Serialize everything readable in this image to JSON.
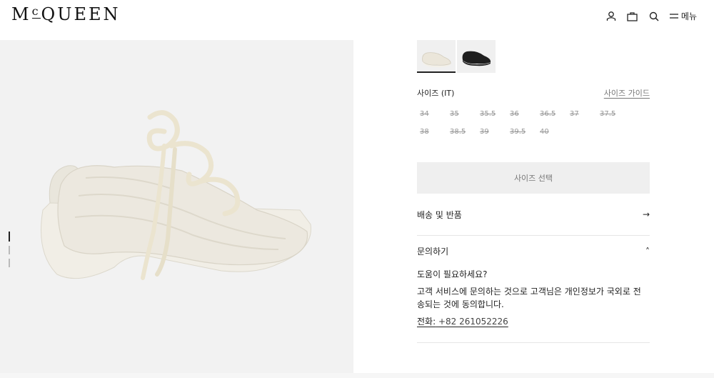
{
  "header": {
    "logo": "McQUEEN",
    "logo_display_left": "M",
    "logo_display_c": "c",
    "logo_display_right": "QUEEN",
    "icons": [
      "user-icon",
      "bag-icon",
      "search-icon",
      "menu-icon"
    ],
    "menu_label": "메뉴"
  },
  "gallery": {
    "image": "ivory-leather-sneaker",
    "pager_count": 3,
    "active_index": 0
  },
  "product": {
    "swatches": [
      {
        "name": "ivory",
        "selected": true
      },
      {
        "name": "black",
        "selected": false
      }
    ],
    "size_label": "사이즈 (IT)",
    "size_guide_label": "사이즈 가이드",
    "sizes": [
      "34",
      "35",
      "35.5",
      "36",
      "36.5",
      "37",
      "37.5",
      "38",
      "38.5",
      "39",
      "39.5",
      "40"
    ],
    "select_size_label": "사이즈 선택",
    "shipping_label": "배송 및 반품",
    "shipping_arrow": "→",
    "inquiry_label": "문의하기",
    "inquiry_caret": "˄",
    "help_question": "도움이 필요하세요?",
    "consent_text": "고객 서비스에 문의하는 것으로 고객님은 개인정보가 국외로 전송되는 것에 동의합니다.",
    "phone_label": "전화:",
    "phone_number": "+82 261052226"
  },
  "colors": {
    "accent": "#222222",
    "panel_bg": "#f2f2f2",
    "button_bg": "#efefef"
  }
}
